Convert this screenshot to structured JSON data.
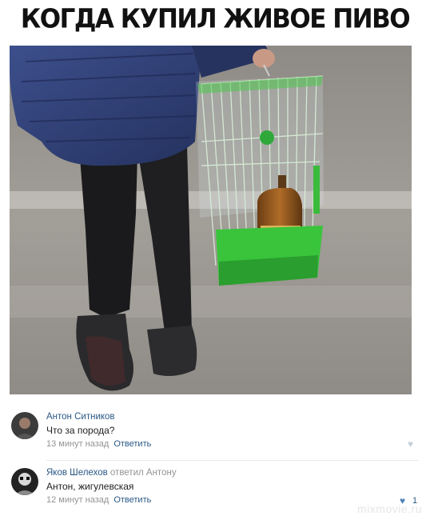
{
  "meme": {
    "title": "КОГДА КУПИЛ ЖИВОЕ ПИВО"
  },
  "comments": [
    {
      "author": "Антон Ситников",
      "text": "Что за порода?",
      "time": "13 минут назад",
      "reply_label": "Ответить",
      "likes": ""
    },
    {
      "author": "Яков Шелехов",
      "replied_to": "ответил Антону",
      "text": "Антон, жигулевская",
      "time": "12 минут назад",
      "reply_label": "Ответить",
      "likes": "1"
    }
  ],
  "watermark": "mixmovie.ru",
  "colors": {
    "link": "#2a5885",
    "muted": "#939393",
    "cage_green": "#3cc23c"
  }
}
